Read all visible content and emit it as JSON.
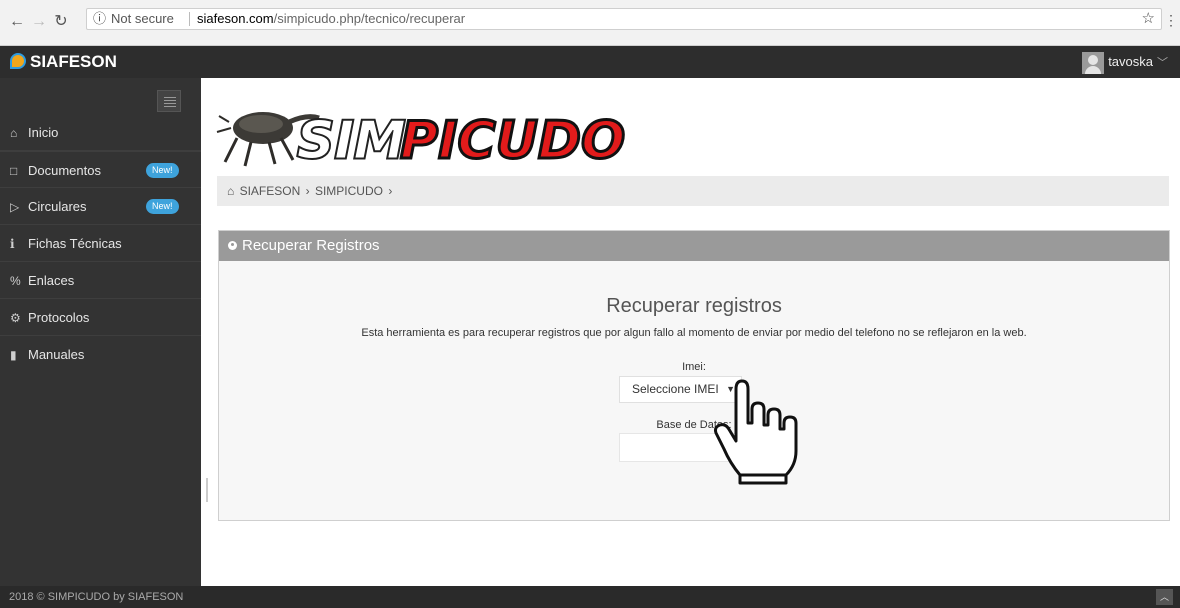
{
  "browser": {
    "security": "Not secure",
    "url_host": "siafeson.com",
    "url_path": "/simpicudo.php/tecnico/recuperar"
  },
  "topbar": {
    "brand": "SIAFESON",
    "username": "tavoska"
  },
  "sidebar": {
    "items": [
      {
        "label": "Inicio",
        "icon": "home-icon"
      },
      {
        "label": "Documentos",
        "icon": "folder-icon",
        "badge": "New!"
      },
      {
        "label": "Circulares",
        "icon": "folder-open-icon",
        "badge": "New!"
      },
      {
        "label": "Fichas Técnicas",
        "icon": "info-icon"
      },
      {
        "label": "Enlaces",
        "icon": "link-icon"
      },
      {
        "label": "Protocolos",
        "icon": "gear-icon"
      },
      {
        "label": "Manuales",
        "icon": "book-icon"
      }
    ]
  },
  "banner": {
    "text_left": "SIM",
    "text_right": "PICUDO"
  },
  "breadcrumb": {
    "items": [
      "SIAFESON",
      "SIMPICUDO"
    ]
  },
  "panel": {
    "heading": "Recuperar Registros",
    "form_title": "Recuperar registros",
    "description": "Esta herramienta es para recuperar registros que por algun fallo al momento de enviar por medio del telefono no se reflejaron en la web.",
    "imei_label": "Imei:",
    "imei_selected": "Seleccione IMEI",
    "db_label": "Base de Datos:"
  },
  "footer": {
    "text": "2018 © SIMPICUDO by SIAFESON"
  },
  "colors": {
    "sidebar_bg": "#333333",
    "topbar_bg": "#2d2d2d",
    "badge": "#3ea3dc",
    "panel_head": "#9a9a9a",
    "banner_red": "#e21b1b"
  }
}
